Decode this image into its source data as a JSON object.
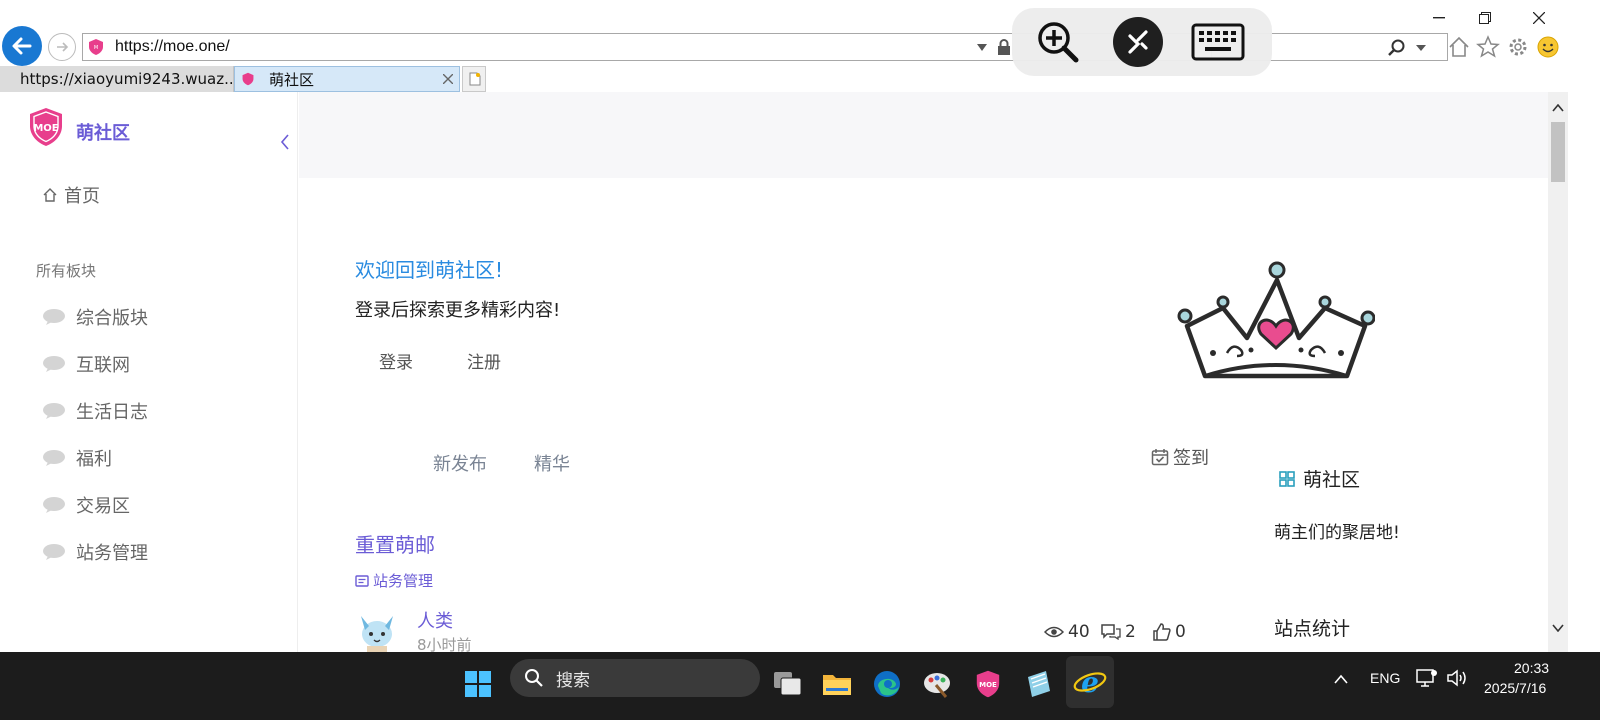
{
  "browser": {
    "url": "https://moe.one/",
    "tabs": [
      {
        "label": "https://xiaoyumi9243.wuaz..."
      },
      {
        "label": "萌社区"
      }
    ]
  },
  "sidebar": {
    "site_name": "萌社区",
    "home_label": "首页",
    "section_label": "所有板块",
    "boards": [
      {
        "label": "综合版块"
      },
      {
        "label": "互联网"
      },
      {
        "label": "生活日志"
      },
      {
        "label": "福利"
      },
      {
        "label": "交易区"
      },
      {
        "label": "站务管理"
      }
    ]
  },
  "hero": {
    "welcome": "欢迎回到萌社区!",
    "subtitle": "登录后探索更多精彩内容!",
    "login_label": "登录",
    "register_label": "注册"
  },
  "feed": {
    "tab_new": "新发布",
    "tab_featured": "精华",
    "checkin_label": "签到",
    "post": {
      "title": "重置萌邮",
      "category": "站务管理",
      "author": "人类",
      "time": "8小时前",
      "views": "40",
      "comments": "2",
      "likes": "0"
    }
  },
  "right_panel": {
    "title": "萌社区",
    "description": "萌主们的聚居地!",
    "stats_title": "站点统计"
  },
  "taskbar": {
    "search_placeholder": "搜索",
    "lang": "ENG",
    "time": "20:33",
    "date": "2025/7/16"
  },
  "colors": {
    "brand_purple": "#6b5cd6",
    "link_blue": "#2a8be0",
    "ie_blue": "#1978d2",
    "logo_pink": "#e83e8c"
  }
}
